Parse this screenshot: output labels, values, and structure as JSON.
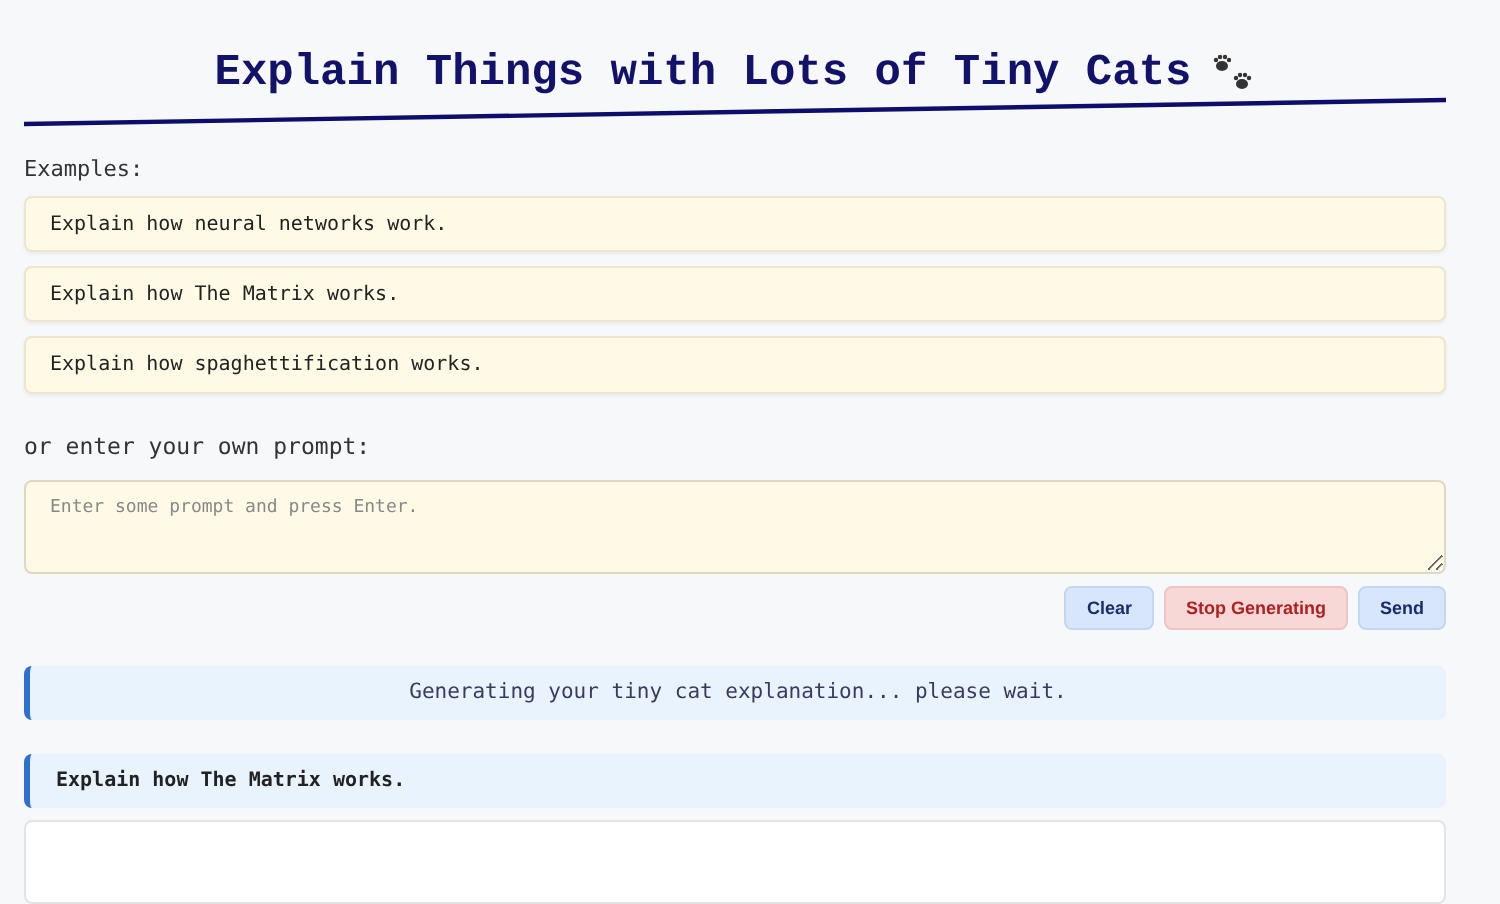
{
  "title": "Explain Things with Lots of Tiny Cats",
  "examples_label": "Examples:",
  "examples": [
    "Explain how neural networks work.",
    "Explain how The Matrix works.",
    "Explain how spaghettification works."
  ],
  "prompt_label": "or enter your own prompt:",
  "prompt_field": {
    "placeholder": "Enter some prompt and press Enter."
  },
  "buttons": [
    {
      "label": "Clear",
      "kind": "neutral"
    },
    {
      "label": "Stop Generating",
      "kind": "danger"
    },
    {
      "label": "Send",
      "kind": "neutral"
    }
  ],
  "status": "Generating your tiny cat explanation... please wait.",
  "current_prompt": "Explain how The Matrix works."
}
